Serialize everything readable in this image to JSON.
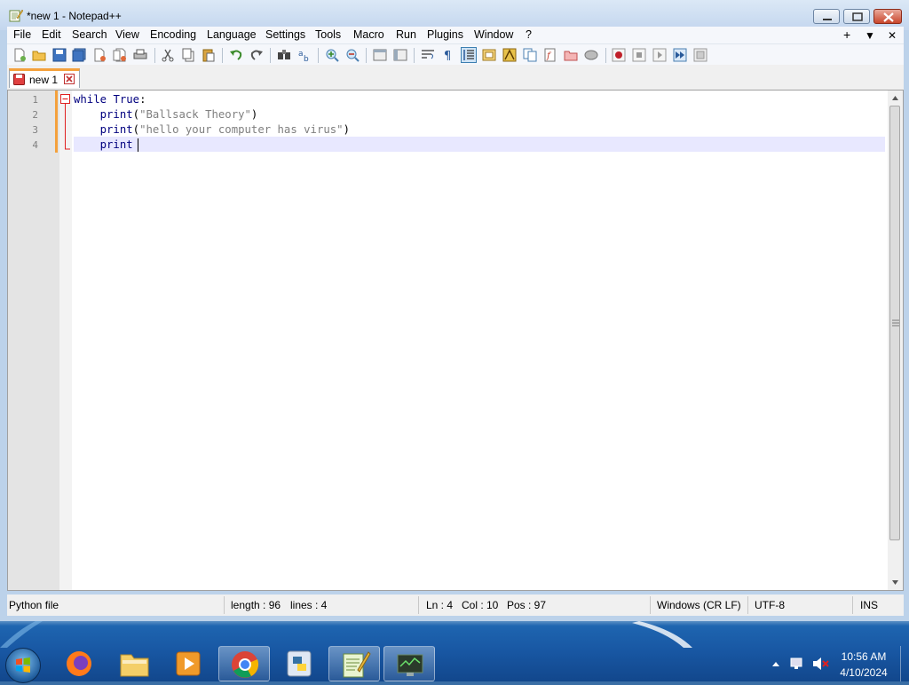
{
  "window": {
    "title": "*new 1 - Notepad++"
  },
  "menu": {
    "items": [
      "File",
      "Edit",
      "Search",
      "View",
      "Encoding",
      "Language",
      "Settings",
      "Tools",
      "Macro",
      "Run",
      "Plugins",
      "Window",
      "?"
    ],
    "right": [
      "+",
      "▼",
      "✕"
    ]
  },
  "tabs": [
    {
      "label": "new 1"
    }
  ],
  "editor": {
    "line_numbers": [
      "1",
      "2",
      "3",
      "4"
    ],
    "lines": [
      {
        "keyword": "while",
        "rest_keyword": "True",
        "rest": ":"
      },
      {
        "indent": "    ",
        "func": "print",
        "open": "(",
        "string": "\"Ballsack Theory\"",
        "close": ")"
      },
      {
        "indent": "    ",
        "func": "print",
        "open": "(",
        "string": "\"hello your computer has virus\"",
        "close": ")"
      },
      {
        "indent": "    ",
        "func": "print",
        "open": "",
        "string": "",
        "close": ""
      }
    ]
  },
  "status": {
    "language": "Python file",
    "length": "length : 96",
    "lines": "lines : 4",
    "ln": "Ln : 4",
    "col": "Col : 10",
    "pos": "Pos : 97",
    "eol": "Windows (CR LF)",
    "encoding": "UTF-8",
    "mode": "INS"
  },
  "taskbar": {
    "time": "10:56 AM",
    "date": "4/10/2024"
  }
}
